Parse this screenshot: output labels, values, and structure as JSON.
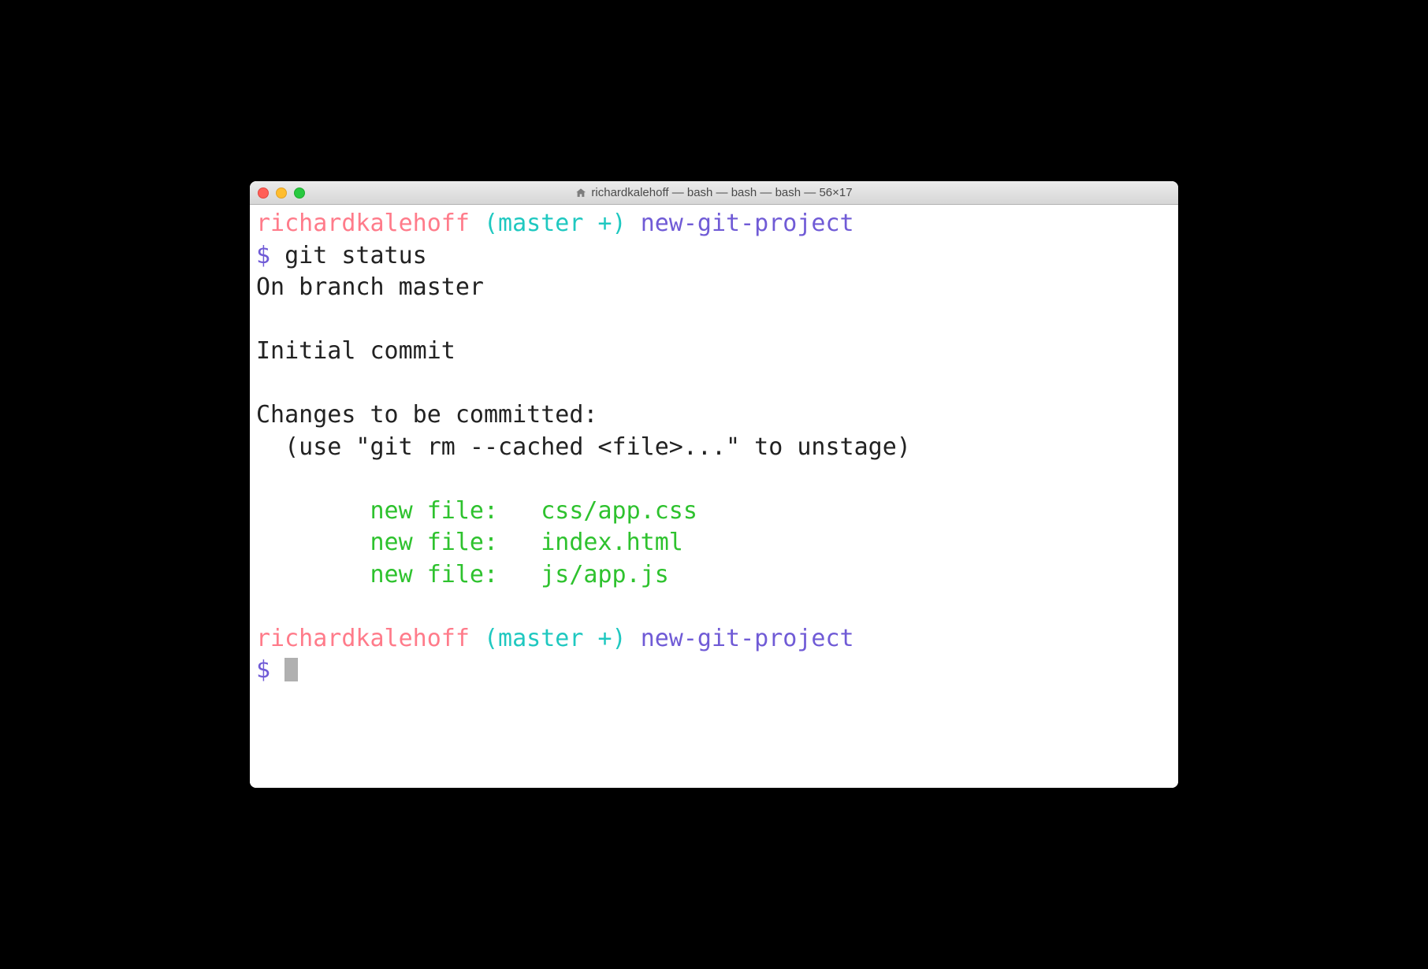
{
  "window": {
    "title": "richardkalehoff — bash — bash — bash — 56×17"
  },
  "prompt": {
    "user": "richardkalehoff",
    "branch": "(master +)",
    "dir": "new-git-project",
    "symbol": "$"
  },
  "session": {
    "command": "git status",
    "output": {
      "branch_line": "On branch master",
      "initial_commit": "Initial commit",
      "changes_header": "Changes to be committed:",
      "unstage_hint": "  (use \"git rm --cached <file>...\" to unstage)",
      "files": [
        {
          "label": "new file:",
          "path": "css/app.css"
        },
        {
          "label": "new file:",
          "path": "index.html"
        },
        {
          "label": "new file:",
          "path": "js/app.js"
        }
      ]
    }
  },
  "colors": {
    "user": "#ff7b8a",
    "branch": "#1fc8c0",
    "dir_prompt": "#705bd6",
    "staged": "#2ec22e"
  }
}
